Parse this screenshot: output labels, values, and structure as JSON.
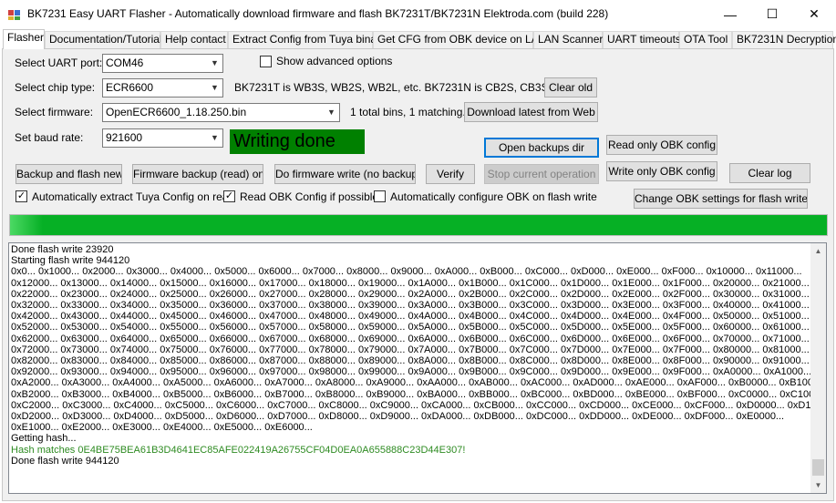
{
  "window": {
    "title": "BK7231 Easy UART Flasher - Automatically download firmware and flash BK7231T/BK7231N  Elektroda.com (build 228)",
    "icon": "app-icon",
    "minimize_glyph": "—",
    "maximize_glyph": "☐",
    "close_glyph": "✕"
  },
  "tabs": [
    {
      "label": "Flasher",
      "active": true
    },
    {
      "label": "Documentation/Tutorials"
    },
    {
      "label": "Help contact"
    },
    {
      "label": "Extract Config from Tuya binary"
    },
    {
      "label": "Get CFG from OBK device on LAN"
    },
    {
      "label": "LAN Scanner"
    },
    {
      "label": "UART timeouts"
    },
    {
      "label": "OTA Tool"
    },
    {
      "label": "BK7231N Decryption"
    }
  ],
  "form": {
    "uart_label": "Select UART port:",
    "uart_value": "COM46",
    "chip_label": "Select chip type:",
    "chip_value": "ECR6600",
    "chip_info": "BK7231T is WB3S, WB2S, WB2L, etc. BK7231N is CB2S, CB3S, etc",
    "firmware_label": "Select firmware:",
    "firmware_value": "OpenECR6600_1.18.250.bin",
    "firmware_info": "1 total bins, 1 matching.",
    "baud_label": "Set baud rate:",
    "baud_value": "921600",
    "status_text": "Writing done",
    "show_advanced_label": "Show advanced options",
    "show_advanced_checked": false
  },
  "buttons": {
    "clear_old": "Clear old",
    "download_latest": "Download latest from Web",
    "open_backups": "Open backups dir",
    "read_only_obk": "Read only OBK config",
    "backup_and_flash": "Backup and flash new",
    "firmware_backup": "Firmware backup (read) only",
    "firmware_write": "Do firmware write (no backup!)",
    "verify": "Verify",
    "stop": "Stop current operation",
    "write_only_obk": "Write only OBK config",
    "clear_log": "Clear log",
    "change_obk_settings": "Change OBK settings for flash write"
  },
  "options": {
    "auto_extract_label": "Automatically extract Tuya Config on read",
    "auto_extract_checked": true,
    "read_obk_label": "Read OBK Config if possible",
    "read_obk_checked": true,
    "auto_configure_label": "Automatically configure OBK on flash write",
    "auto_configure_checked": false
  },
  "progress": {
    "percent": 100,
    "color": "#06b025"
  },
  "colors": {
    "status_bg": "#008000",
    "log_hash": "#2e8b22",
    "accent": "#0078d7"
  },
  "log": {
    "lines": [
      "Done flash write 23920",
      "Starting flash write 944120",
      "0x0... 0x1000... 0x2000... 0x3000... 0x4000... 0x5000... 0x6000... 0x7000... 0x8000... 0x9000... 0xA000... 0xB000... 0xC000... 0xD000... 0xE000... 0xF000... 0x10000... 0x11000...",
      "0x12000... 0x13000... 0x14000... 0x15000... 0x16000... 0x17000... 0x18000... 0x19000... 0x1A000... 0x1B000... 0x1C000... 0x1D000... 0x1E000... 0x1F000... 0x20000... 0x21000...",
      "0x22000... 0x23000... 0x24000... 0x25000... 0x26000... 0x27000... 0x28000... 0x29000... 0x2A000... 0x2B000... 0x2C000... 0x2D000... 0x2E000... 0x2F000... 0x30000... 0x31000...",
      "0x32000... 0x33000... 0x34000... 0x35000... 0x36000... 0x37000... 0x38000... 0x39000... 0x3A000... 0x3B000... 0x3C000... 0x3D000... 0x3E000... 0x3F000... 0x40000... 0x41000...",
      "0x42000... 0x43000... 0x44000... 0x45000... 0x46000... 0x47000... 0x48000... 0x49000... 0x4A000... 0x4B000... 0x4C000... 0x4D000... 0x4E000... 0x4F000... 0x50000... 0x51000...",
      "0x52000... 0x53000... 0x54000... 0x55000... 0x56000... 0x57000... 0x58000... 0x59000... 0x5A000... 0x5B000... 0x5C000... 0x5D000... 0x5E000... 0x5F000... 0x60000... 0x61000...",
      "0x62000... 0x63000... 0x64000... 0x65000... 0x66000... 0x67000... 0x68000... 0x69000... 0x6A000... 0x6B000... 0x6C000... 0x6D000... 0x6E000... 0x6F000... 0x70000... 0x71000...",
      "0x72000... 0x73000... 0x74000... 0x75000... 0x76000... 0x77000... 0x78000... 0x79000... 0x7A000... 0x7B000... 0x7C000... 0x7D000... 0x7E000... 0x7F000... 0x80000... 0x81000...",
      "0x82000... 0x83000... 0x84000... 0x85000... 0x86000... 0x87000... 0x88000... 0x89000... 0x8A000... 0x8B000... 0x8C000... 0x8D000... 0x8E000... 0x8F000... 0x90000... 0x91000...",
      "0x92000... 0x93000... 0x94000... 0x95000... 0x96000... 0x97000... 0x98000... 0x99000... 0x9A000... 0x9B000... 0x9C000... 0x9D000... 0x9E000... 0x9F000... 0xA0000... 0xA1000...",
      "0xA2000... 0xA3000... 0xA4000... 0xA5000... 0xA6000... 0xA7000... 0xA8000... 0xA9000... 0xAA000... 0xAB000... 0xAC000... 0xAD000... 0xAE000... 0xAF000... 0xB0000... 0xB1000...",
      "0xB2000... 0xB3000... 0xB4000... 0xB5000... 0xB6000... 0xB7000... 0xB8000... 0xB9000... 0xBA000... 0xBB000... 0xBC000... 0xBD000... 0xBE000... 0xBF000... 0xC0000... 0xC1000...",
      "0xC2000... 0xC3000... 0xC4000... 0xC5000... 0xC6000... 0xC7000... 0xC8000... 0xC9000... 0xCA000... 0xCB000... 0xCC000... 0xCD000... 0xCE000... 0xCF000... 0xD0000... 0xD1000...",
      "0xD2000... 0xD3000... 0xD4000... 0xD5000... 0xD6000... 0xD7000... 0xD8000... 0xD9000... 0xDA000... 0xDB000... 0xDC000... 0xDD000... 0xDE000... 0xDF000... 0xE0000...",
      "0xE1000... 0xE2000... 0xE3000... 0xE4000... 0xE5000... 0xE6000...",
      "Getting hash..."
    ],
    "hash_line": "Hash matches 0E4BE75BEA61B3D4641EC85AFE022419A26755CF04D0EA0A655888C23D44E307!",
    "final_line": "Done flash write 944120"
  }
}
